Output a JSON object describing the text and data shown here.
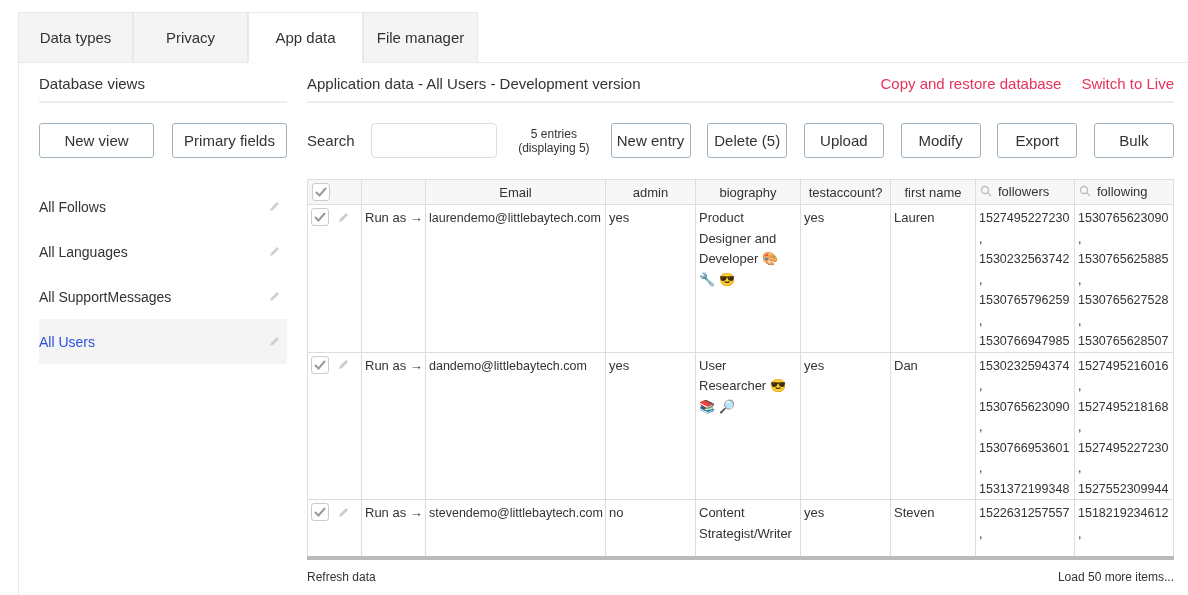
{
  "tabs": [
    {
      "label": "Data types",
      "selected": false
    },
    {
      "label": "Privacy",
      "selected": false
    },
    {
      "label": "App data",
      "selected": true
    },
    {
      "label": "File manager",
      "selected": false
    }
  ],
  "sidebar": {
    "title": "Database views",
    "buttons": [
      "New view",
      "Primary fields"
    ],
    "items": [
      {
        "label": "All Follows",
        "selected": false
      },
      {
        "label": "All Languages",
        "selected": false
      },
      {
        "label": "All SupportMessages",
        "selected": false
      },
      {
        "label": "All Users",
        "selected": true
      }
    ]
  },
  "main": {
    "title": "Application data - All Users - Development version",
    "links": [
      "Copy and restore database",
      "Switch to Live"
    ],
    "search": {
      "label": "Search"
    },
    "entries": "5 entries",
    "displaying": "(displaying 5)",
    "buttons": [
      "New entry",
      "Delete (5)",
      "Upload",
      "Modify",
      "Export",
      "Bulk"
    ],
    "table": {
      "all_checked": true,
      "columns": [
        {
          "label": "Email",
          "search": false
        },
        {
          "label": "admin",
          "search": false
        },
        {
          "label": "biography",
          "search": false
        },
        {
          "label": "testaccount?",
          "search": false
        },
        {
          "label": "first name",
          "search": false
        },
        {
          "label": "followers",
          "search": true
        },
        {
          "label": "following",
          "search": true
        }
      ],
      "rows": [
        {
          "checked": true,
          "run_as": "Run as →",
          "email": "laurendemo@littlebaytech.com",
          "admin": "yes",
          "biography": "Product Designer and Developer 🎨 🔧 😎",
          "testaccount": "yes",
          "first_name": "Lauren",
          "followers": [
            "1527495227230",
            ",",
            "1530232563742",
            ",",
            "1530765796259",
            ",",
            "1530766947985"
          ],
          "following": [
            "1530765623090",
            ",",
            "1530765625885",
            ",",
            "1530765627528",
            ",",
            "1530765628507"
          ]
        },
        {
          "checked": true,
          "run_as": "Run as →",
          "email": "dandemo@littlebaytech.com",
          "admin": "yes",
          "biography": "User Researcher 😎 📚 🔎",
          "testaccount": "yes",
          "first_name": "Dan",
          "followers": [
            "1530232594374",
            ",",
            "1530765623090",
            ",",
            "1530766953601",
            ",",
            "1531372199348"
          ],
          "following": [
            "1527495216016",
            ",",
            "1527495218168",
            ",",
            "1527495227230",
            ",",
            "1527552309944"
          ]
        },
        {
          "checked": true,
          "run_as": "Run as →",
          "email": "stevendemo@littlebaytech.com",
          "admin": "no",
          "biography": "Content Strategist/Writer",
          "testaccount": "yes",
          "first_name": "Steven",
          "followers": [
            "1522631257557",
            ","
          ],
          "following": [
            "1518219234612",
            ","
          ]
        }
      ]
    },
    "footer": {
      "refresh": "Refresh data",
      "load_more": "Load 50 more items..."
    }
  }
}
